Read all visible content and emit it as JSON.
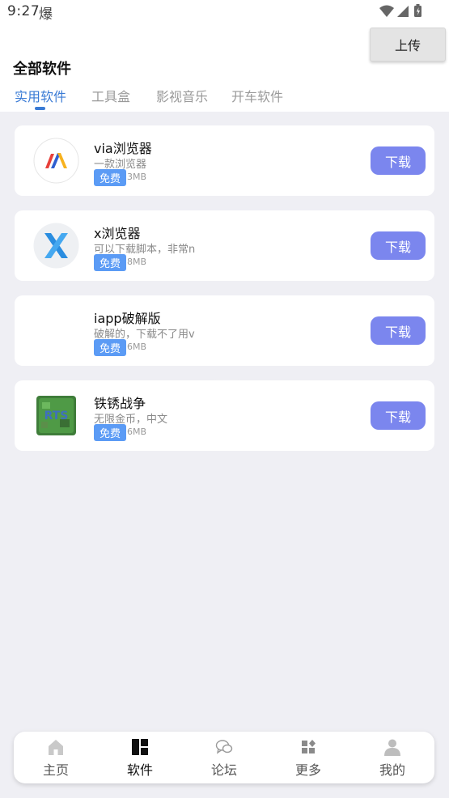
{
  "status_bar": {
    "time": "9:27",
    "app_glyph": "爆",
    "icons": [
      "wifi-icon",
      "signal-icon",
      "battery-icon"
    ]
  },
  "header": {
    "title": "全部软件",
    "upload_label": "上传"
  },
  "tabs": [
    {
      "label": "实用软件",
      "active": true
    },
    {
      "label": "工具盒",
      "active": false
    },
    {
      "label": "影视音乐",
      "active": false
    },
    {
      "label": "开车软件",
      "active": false
    }
  ],
  "apps": [
    {
      "name": "via浏览器",
      "desc": "一款浏览器",
      "tag": "免费",
      "size": "3MB",
      "button": "下载",
      "icon": "via-browser-icon"
    },
    {
      "name": "x浏览器",
      "desc": "可以下载脚本，非常n",
      "tag": "免费",
      "size": "8MB",
      "button": "下载",
      "icon": "x-browser-icon"
    },
    {
      "name": "iapp破解版",
      "desc": "破解的，下载不了用v",
      "tag": "免费",
      "size": "6MB",
      "button": "下载",
      "icon": "iapp-icon"
    },
    {
      "name": "铁锈战争",
      "desc": "无限金币，中文",
      "tag": "免费",
      "size": "6MB",
      "button": "下载",
      "icon": "rusted-warfare-icon"
    }
  ],
  "bottom_nav": [
    {
      "label": "主页",
      "icon": "home-icon",
      "active": false
    },
    {
      "label": "软件",
      "icon": "apps-grid-icon",
      "active": true
    },
    {
      "label": "论坛",
      "icon": "chat-bubbles-icon",
      "active": false
    },
    {
      "label": "更多",
      "icon": "more-icon",
      "active": false
    },
    {
      "label": "我的",
      "icon": "person-icon",
      "active": false
    }
  ],
  "colors": {
    "accent": "#3a7bd5",
    "download_button": "#7b86ee",
    "tag": "#5b9bf5",
    "background": "#efeff4"
  }
}
